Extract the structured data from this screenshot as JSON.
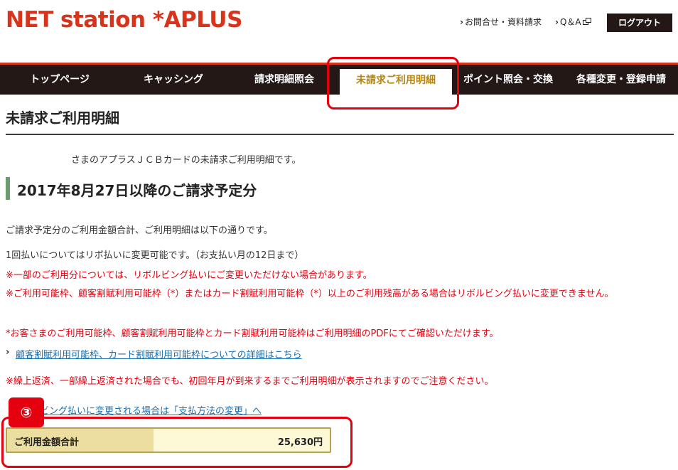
{
  "header": {
    "logo": "NET station *APLUS",
    "links": {
      "contact": "お問合せ・資料請求",
      "faq": "Q＆A",
      "logout": "ログアウト"
    }
  },
  "nav": {
    "items": [
      "トップページ",
      "キャッシング",
      "請求明細照会",
      "未請求ご利用明細",
      "ポイント照会・交換",
      "各種変更・登録申請"
    ],
    "active_index": 3
  },
  "page": {
    "title": "未請求ご利用明細",
    "intro": "さまのアプラスＪＣＢカードの未請求ご利用明細です。",
    "section_title": "2017年8月27日以降のご請求予定分",
    "summary": "ご請求予定分のご利用金額合計、ご利用明細は以下の通りです。",
    "revolving_note": "1回払いについてはリボ払いに変更可能です。（お支払い月の12日まで）",
    "notes_red": [
      "※一部のご利用分については、リボルビング払いにご変更いただけない場合があります。",
      "※ご利用可能枠、顧客割賦利用可能枠（*）またはカード割賦利用可能枠（*）以上のご利用残高がある場合はリボルビング払いに変更できません。",
      "*お客さまのご利用可能枠、顧客割賦利用可能枠とカード割賦利用可能枠はご利用明細のPDFにてご確認いただけます。"
    ],
    "detail_link": "顧客割賦利用可能枠、カード割賦利用可能枠についての詳細はこちら",
    "repayment_note": "※繰上返済、一部繰上返済された場合でも、初回年月が到来するまでご利用明細が表示されますのでご注意ください。",
    "revolving_link": "ビング払いに変更される場合は「支払方法の変更」へ",
    "step_badge": "③",
    "total": {
      "label": "ご利用金額合計",
      "value": "25,630円"
    }
  },
  "colors": {
    "brand_red": "#d8331b",
    "nav_bg": "#231815",
    "active_nav_text": "#b8860b",
    "highlight_red": "#e5000f",
    "link_blue": "#1a6fb0",
    "section_bar_green": "#6b9c6e"
  }
}
